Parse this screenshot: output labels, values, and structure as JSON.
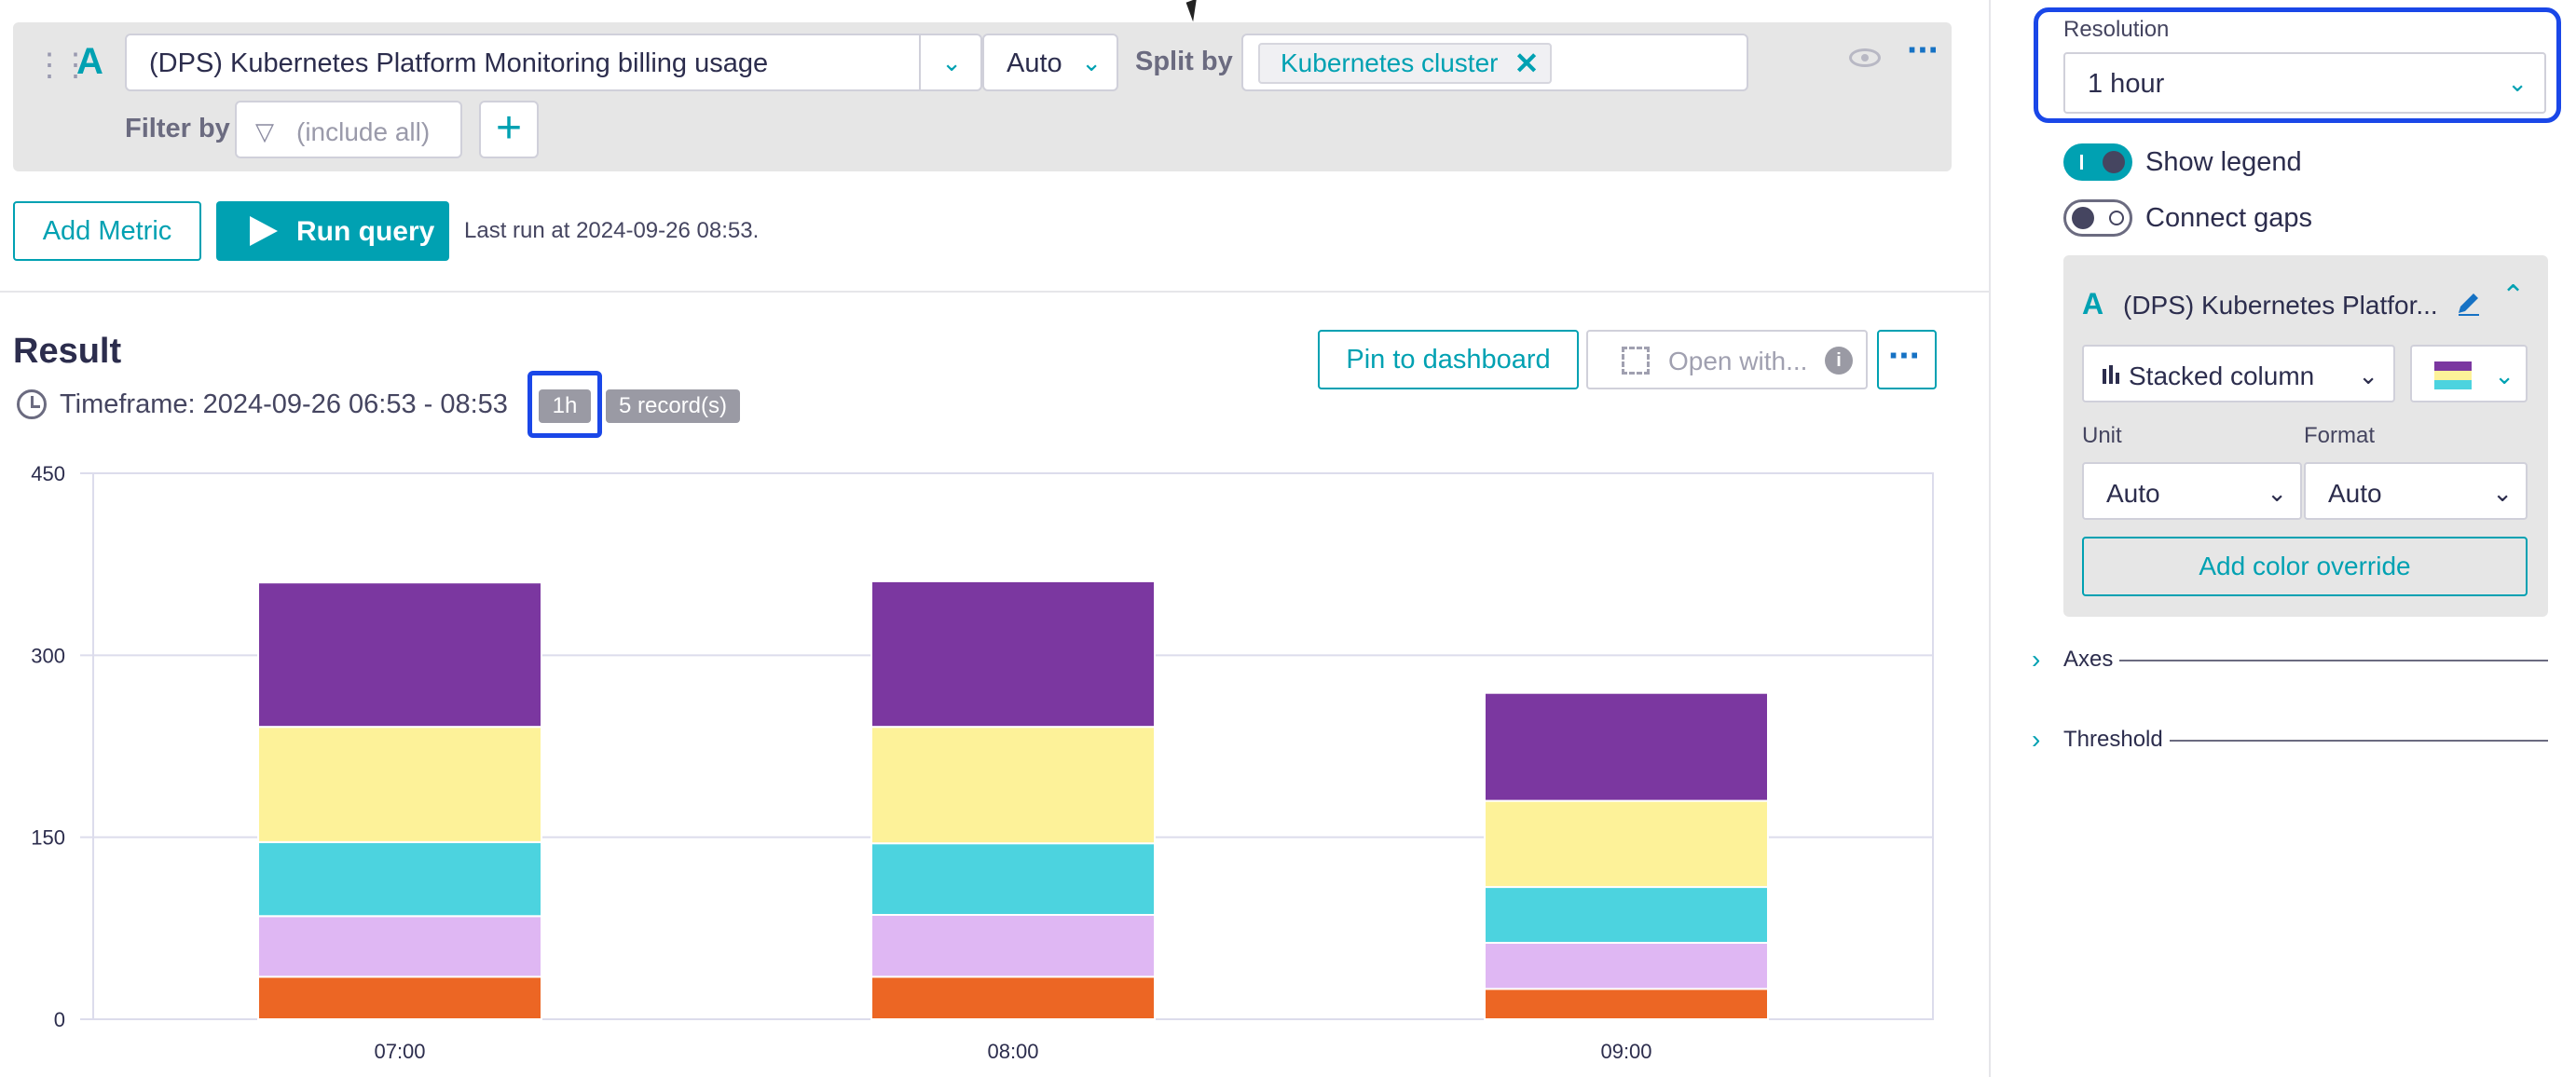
{
  "query": {
    "letter": "A",
    "metric": "(DPS) Kubernetes Platform Monitoring billing usage",
    "aggregation": "Auto",
    "split_by_label": "Split by",
    "split_chip": "Kubernetes cluster",
    "filter_label": "Filter by",
    "filter_placeholder": "(include all)"
  },
  "actions": {
    "add_metric": "Add Metric",
    "run_query": "Run query",
    "last_run": "Last run at 2024-09-26 08:53."
  },
  "result": {
    "title": "Result",
    "timeframe": "Timeframe: 2024-09-26 06:53 - 08:53",
    "resolution_badge": "1h",
    "records_badge": "5 record(s)",
    "pin_button": "Pin to dashboard",
    "open_with": "Open with...",
    "more": "•••"
  },
  "chart_data": {
    "type": "bar",
    "stacked": true,
    "categories": [
      "07:00",
      "08:00",
      "09:00"
    ],
    "ylim": [
      0,
      450
    ],
    "yticks": [
      0,
      150,
      300,
      450
    ],
    "grid": true,
    "series": [
      {
        "color": "#ec6624",
        "values": [
          35,
          35,
          25
        ]
      },
      {
        "color": "#dfb7f3",
        "values": [
          50,
          51,
          38
        ]
      },
      {
        "color": "#4cd3df",
        "values": [
          61,
          59,
          46
        ]
      },
      {
        "color": "#fdf299",
        "values": [
          95,
          96,
          71
        ]
      },
      {
        "color": "#7b37a0",
        "values": [
          119,
          120,
          89
        ]
      }
    ]
  },
  "panel": {
    "resolution_label": "Resolution",
    "resolution_value": "1 hour",
    "show_legend": "Show legend",
    "connect_gaps": "Connect gaps",
    "series_letter": "A",
    "series_name": "(DPS) Kubernetes Platfor...",
    "chart_type": "Stacked column",
    "unit_label": "Unit",
    "unit_value": "Auto",
    "format_label": "Format",
    "format_value": "Auto",
    "add_color_override": "Add color override",
    "axes": "Axes",
    "threshold": "Threshold"
  },
  "colors": {
    "accent": "#00a1b2",
    "focus": "#1a47e8"
  }
}
